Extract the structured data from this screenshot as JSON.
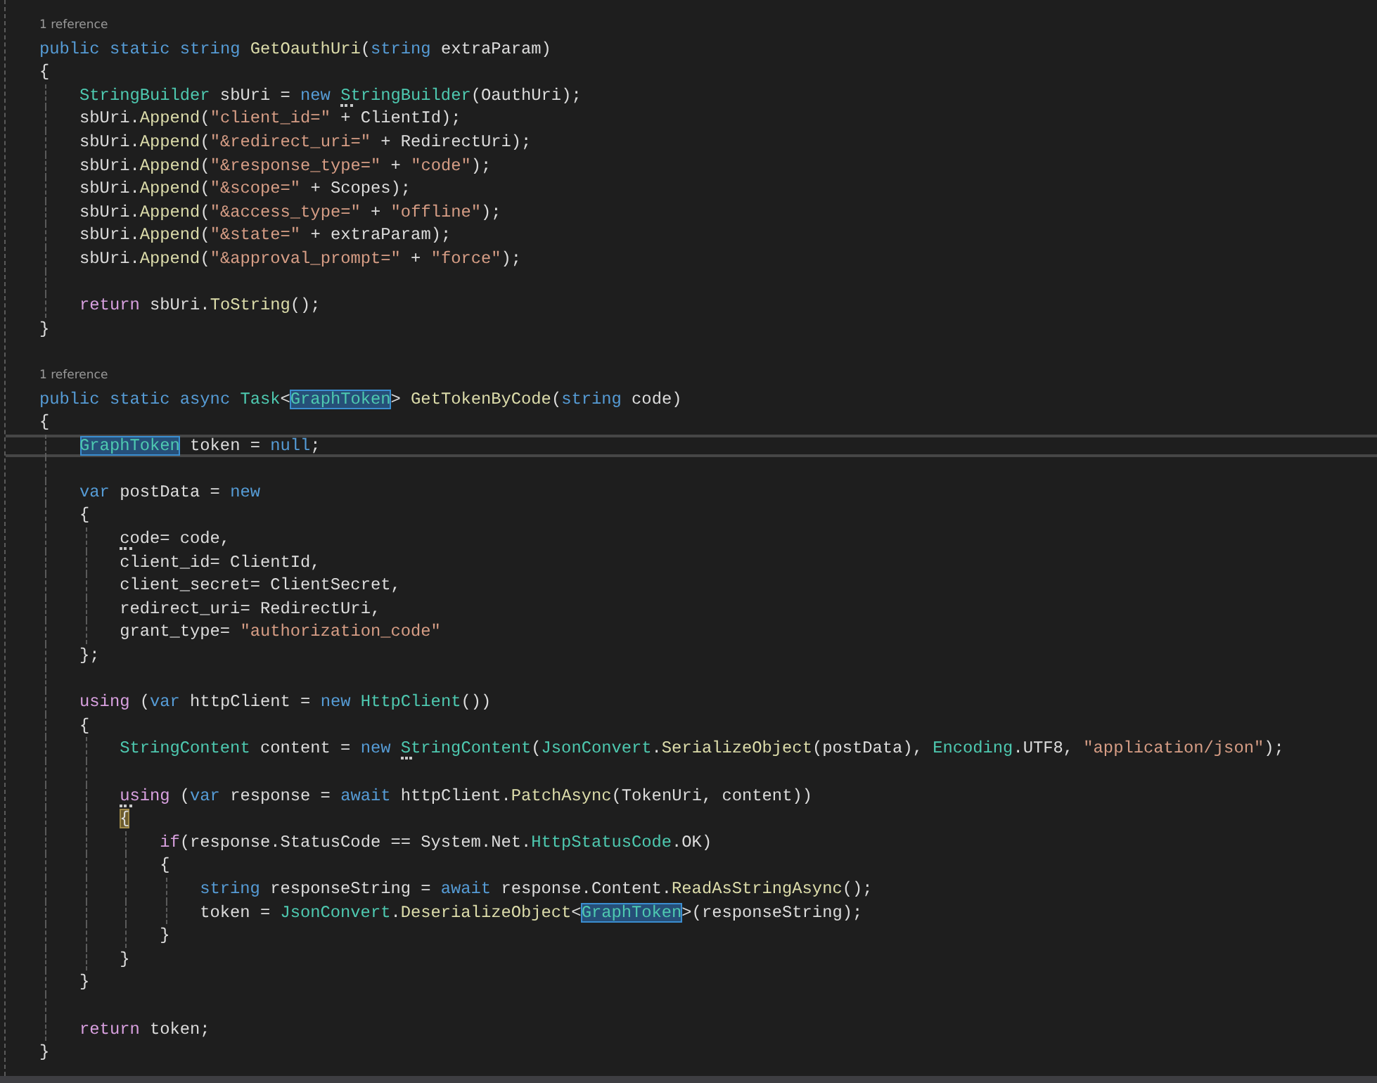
{
  "editor": {
    "lines": [
      {
        "kind": "codelens",
        "text": "1 reference"
      },
      {
        "kind": "code",
        "tokens": [
          {
            "text": "public static string ",
            "kind": "keyword"
          },
          {
            "text": "GetOauthUri",
            "kind": "method"
          },
          {
            "text": "(",
            "kind": "plain"
          },
          {
            "text": "string ",
            "kind": "keyword"
          },
          {
            "text": "extraParam)",
            "kind": "plain"
          }
        ]
      },
      {
        "kind": "code",
        "tokens": [
          {
            "text": "{",
            "kind": "plain"
          }
        ],
        "children": [
          {
            "kind": "code",
            "tokens": [
              {
                "text": "StringBuilder",
                "kind": "type"
              },
              {
                "text": " sbUri = ",
                "kind": "plain"
              },
              {
                "text": "new ",
                "kind": "keyword"
              },
              {
                "text": "StringBuilder",
                "kind": "type",
                "suggestion": true
              },
              {
                "text": "(OauthUri);",
                "kind": "plain"
              }
            ]
          },
          {
            "kind": "code",
            "tokens": [
              {
                "text": "sbUri.",
                "kind": "plain"
              },
              {
                "text": "Append",
                "kind": "method"
              },
              {
                "text": "(",
                "kind": "plain"
              },
              {
                "text": "\"client_id=\"",
                "kind": "string"
              },
              {
                "text": " + ClientId);",
                "kind": "plain"
              }
            ]
          },
          {
            "kind": "code",
            "tokens": [
              {
                "text": "sbUri.",
                "kind": "plain"
              },
              {
                "text": "Append",
                "kind": "method"
              },
              {
                "text": "(",
                "kind": "plain"
              },
              {
                "text": "\"&redirect_uri=\"",
                "kind": "string"
              },
              {
                "text": " + RedirectUri);",
                "kind": "plain"
              }
            ]
          },
          {
            "kind": "code",
            "tokens": [
              {
                "text": "sbUri.",
                "kind": "plain"
              },
              {
                "text": "Append",
                "kind": "method"
              },
              {
                "text": "(",
                "kind": "plain"
              },
              {
                "text": "\"&response_type=\"",
                "kind": "string"
              },
              {
                "text": " + ",
                "kind": "plain"
              },
              {
                "text": "\"code\"",
                "kind": "string"
              },
              {
                "text": ");",
                "kind": "plain"
              }
            ]
          },
          {
            "kind": "code",
            "tokens": [
              {
                "text": "sbUri.",
                "kind": "plain"
              },
              {
                "text": "Append",
                "kind": "method"
              },
              {
                "text": "(",
                "kind": "plain"
              },
              {
                "text": "\"&scope=\"",
                "kind": "string"
              },
              {
                "text": " + Scopes);",
                "kind": "plain"
              }
            ]
          },
          {
            "kind": "code",
            "tokens": [
              {
                "text": "sbUri.",
                "kind": "plain"
              },
              {
                "text": "Append",
                "kind": "method"
              },
              {
                "text": "(",
                "kind": "plain"
              },
              {
                "text": "\"&access_type=\"",
                "kind": "string"
              },
              {
                "text": " + ",
                "kind": "plain"
              },
              {
                "text": "\"offline\"",
                "kind": "string"
              },
              {
                "text": ");",
                "kind": "plain"
              }
            ]
          },
          {
            "kind": "code",
            "tokens": [
              {
                "text": "sbUri.",
                "kind": "plain"
              },
              {
                "text": "Append",
                "kind": "method"
              },
              {
                "text": "(",
                "kind": "plain"
              },
              {
                "text": "\"&state=\"",
                "kind": "string"
              },
              {
                "text": " + extraParam);",
                "kind": "plain"
              }
            ]
          },
          {
            "kind": "code",
            "tokens": [
              {
                "text": "sbUri.",
                "kind": "plain"
              },
              {
                "text": "Append",
                "kind": "method"
              },
              {
                "text": "(",
                "kind": "plain"
              },
              {
                "text": "\"&approval_prompt=\"",
                "kind": "string"
              },
              {
                "text": " + ",
                "kind": "plain"
              },
              {
                "text": "\"force\"",
                "kind": "string"
              },
              {
                "text": ");",
                "kind": "plain"
              }
            ]
          },
          {
            "kind": "blank"
          },
          {
            "kind": "code",
            "tokens": [
              {
                "text": "return",
                "kind": "control"
              },
              {
                "text": " sbUri.",
                "kind": "plain"
              },
              {
                "text": "ToString",
                "kind": "method"
              },
              {
                "text": "();",
                "kind": "plain"
              }
            ]
          }
        ]
      },
      {
        "kind": "code",
        "tokens": [
          {
            "text": "}",
            "kind": "plain"
          }
        ]
      },
      {
        "kind": "blank"
      },
      {
        "kind": "codelens",
        "text": "1 reference"
      },
      {
        "kind": "code",
        "tokens": [
          {
            "text": "public static async ",
            "kind": "keyword"
          },
          {
            "text": "Task",
            "kind": "type"
          },
          {
            "text": "<",
            "kind": "plain"
          },
          {
            "text": "GraphToken",
            "kind": "type",
            "highlighted": true
          },
          {
            "text": "> ",
            "kind": "plain"
          },
          {
            "text": "GetTokenByCode",
            "kind": "method"
          },
          {
            "text": "(",
            "kind": "plain"
          },
          {
            "text": "string ",
            "kind": "keyword"
          },
          {
            "text": "code)",
            "kind": "plain"
          }
        ]
      },
      {
        "kind": "code",
        "tokens": [
          {
            "text": "{",
            "kind": "plain"
          }
        ],
        "children": [
          {
            "kind": "code",
            "current": true,
            "tokens": [
              {
                "text": "GraphToken",
                "kind": "type",
                "highlighted": true
              },
              {
                "text": " token = ",
                "kind": "plain"
              },
              {
                "text": "null",
                "kind": "keyword"
              },
              {
                "text": ";",
                "kind": "plain"
              }
            ]
          },
          {
            "kind": "blank"
          },
          {
            "kind": "code",
            "tokens": [
              {
                "text": "var ",
                "kind": "keyword"
              },
              {
                "text": "postData = ",
                "kind": "plain"
              },
              {
                "text": "new",
                "kind": "keyword"
              }
            ]
          },
          {
            "kind": "code",
            "tokens": [
              {
                "text": "{",
                "kind": "plain"
              }
            ],
            "children": [
              {
                "kind": "code",
                "tokens": [
                  {
                    "text": "code",
                    "kind": "plain",
                    "suggestion": true
                  },
                  {
                    "text": "= code,",
                    "kind": "plain"
                  }
                ]
              },
              {
                "kind": "code",
                "tokens": [
                  {
                    "text": "client_id= ClientId,",
                    "kind": "plain"
                  }
                ]
              },
              {
                "kind": "code",
                "tokens": [
                  {
                    "text": "client_secret= ClientSecret,",
                    "kind": "plain"
                  }
                ]
              },
              {
                "kind": "code",
                "tokens": [
                  {
                    "text": "redirect_uri= RedirectUri,",
                    "kind": "plain"
                  }
                ]
              },
              {
                "kind": "code",
                "tokens": [
                  {
                    "text": "grant_type= ",
                    "kind": "plain"
                  },
                  {
                    "text": "\"authorization_code\"",
                    "kind": "string"
                  }
                ]
              }
            ]
          },
          {
            "kind": "code",
            "tokens": [
              {
                "text": "};",
                "kind": "plain"
              }
            ]
          },
          {
            "kind": "blank"
          },
          {
            "kind": "code",
            "tokens": [
              {
                "text": "using",
                "kind": "control"
              },
              {
                "text": " (",
                "kind": "plain"
              },
              {
                "text": "var ",
                "kind": "keyword"
              },
              {
                "text": "httpClient = ",
                "kind": "plain"
              },
              {
                "text": "new ",
                "kind": "keyword"
              },
              {
                "text": "HttpClient",
                "kind": "type"
              },
              {
                "text": "())",
                "kind": "plain"
              }
            ]
          },
          {
            "kind": "code",
            "tokens": [
              {
                "text": "{",
                "kind": "plain"
              }
            ],
            "children": [
              {
                "kind": "code",
                "tokens": [
                  {
                    "text": "StringContent",
                    "kind": "type"
                  },
                  {
                    "text": " content = ",
                    "kind": "plain"
                  },
                  {
                    "text": "new ",
                    "kind": "keyword"
                  },
                  {
                    "text": "StringContent",
                    "kind": "type",
                    "suggestion": true
                  },
                  {
                    "text": "(",
                    "kind": "plain"
                  },
                  {
                    "text": "JsonConvert",
                    "kind": "type"
                  },
                  {
                    "text": ".",
                    "kind": "plain"
                  },
                  {
                    "text": "SerializeObject",
                    "kind": "method"
                  },
                  {
                    "text": "(postData), ",
                    "kind": "plain"
                  },
                  {
                    "text": "Encoding",
                    "kind": "type"
                  },
                  {
                    "text": ".UTF8, ",
                    "kind": "plain"
                  },
                  {
                    "text": "\"application/json\"",
                    "kind": "string"
                  },
                  {
                    "text": ");",
                    "kind": "plain"
                  }
                ]
              },
              {
                "kind": "blank"
              },
              {
                "kind": "code",
                "tokens": [
                  {
                    "text": "using",
                    "kind": "control",
                    "suggestion": true
                  },
                  {
                    "text": " (",
                    "kind": "plain"
                  },
                  {
                    "text": "var ",
                    "kind": "keyword"
                  },
                  {
                    "text": "response = ",
                    "kind": "plain"
                  },
                  {
                    "text": "await ",
                    "kind": "keyword"
                  },
                  {
                    "text": "httpClient.",
                    "kind": "plain"
                  },
                  {
                    "text": "PatchAsync",
                    "kind": "method"
                  },
                  {
                    "text": "(TokenUri, content))",
                    "kind": "plain"
                  }
                ]
              },
              {
                "kind": "code",
                "tokens": [
                  {
                    "text": "{",
                    "kind": "plain",
                    "brace_matched": true
                  }
                ],
                "children": [
                  {
                    "kind": "code",
                    "tokens": [
                      {
                        "text": "if",
                        "kind": "control"
                      },
                      {
                        "text": "(response.StatusCode == System.Net.",
                        "kind": "plain"
                      },
                      {
                        "text": "HttpStatusCode",
                        "kind": "type"
                      },
                      {
                        "text": ".OK)",
                        "kind": "plain"
                      }
                    ]
                  },
                  {
                    "kind": "code",
                    "tokens": [
                      {
                        "text": "{",
                        "kind": "plain"
                      }
                    ],
                    "children": [
                      {
                        "kind": "code",
                        "tokens": [
                          {
                            "text": "string ",
                            "kind": "keyword"
                          },
                          {
                            "text": "responseString = ",
                            "kind": "plain"
                          },
                          {
                            "text": "await ",
                            "kind": "keyword"
                          },
                          {
                            "text": "response.Content.",
                            "kind": "plain"
                          },
                          {
                            "text": "ReadAsStringAsync",
                            "kind": "method"
                          },
                          {
                            "text": "();",
                            "kind": "plain"
                          }
                        ]
                      },
                      {
                        "kind": "code",
                        "tokens": [
                          {
                            "text": "token = ",
                            "kind": "plain"
                          },
                          {
                            "text": "JsonConvert",
                            "kind": "type"
                          },
                          {
                            "text": ".",
                            "kind": "plain"
                          },
                          {
                            "text": "DeserializeObject",
                            "kind": "method"
                          },
                          {
                            "text": "<",
                            "kind": "plain"
                          },
                          {
                            "text": "GraphToken",
                            "kind": "type",
                            "highlighted": true
                          },
                          {
                            "text": ">(responseString);",
                            "kind": "plain"
                          }
                        ]
                      }
                    ]
                  },
                  {
                    "kind": "code",
                    "tokens": [
                      {
                        "text": "}",
                        "kind": "plain"
                      }
                    ]
                  }
                ]
              },
              {
                "kind": "code",
                "tokens": [
                  {
                    "text": "}",
                    "kind": "plain"
                  }
                ]
              }
            ]
          },
          {
            "kind": "code",
            "tokens": [
              {
                "text": "}",
                "kind": "plain"
              }
            ]
          },
          {
            "kind": "blank"
          },
          {
            "kind": "code",
            "tokens": [
              {
                "text": "return",
                "kind": "control"
              },
              {
                "text": " token;",
                "kind": "plain"
              }
            ]
          }
        ]
      },
      {
        "kind": "code",
        "tokens": [
          {
            "text": "}",
            "kind": "plain"
          }
        ]
      }
    ]
  }
}
